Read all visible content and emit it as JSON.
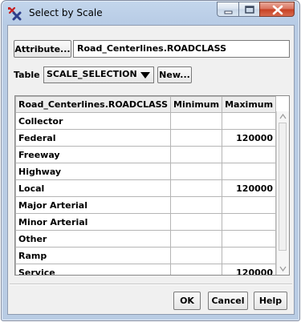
{
  "window": {
    "title": "Select by Scale",
    "icon": "scale-select-app-icon",
    "controls": [
      "minimize-icon",
      "maximize-icon",
      "close-icon"
    ]
  },
  "attribute": {
    "button_label": "Attribute...",
    "value": "Road_Centerlines.ROADCLASS"
  },
  "table_row": {
    "label": "Table",
    "selected": "SCALE_SELECTION",
    "new_label": "New..."
  },
  "grid": {
    "columns": [
      "Road_Centerlines.ROADCLASS",
      "Minimum",
      "Maximum"
    ],
    "rows": [
      {
        "name": "Collector",
        "min": "",
        "max": ""
      },
      {
        "name": "Federal",
        "min": "",
        "max": "120000"
      },
      {
        "name": "Freeway",
        "min": "",
        "max": ""
      },
      {
        "name": "Highway",
        "min": "",
        "max": ""
      },
      {
        "name": "Local",
        "min": "",
        "max": "120000"
      },
      {
        "name": "Major Arterial",
        "min": "",
        "max": ""
      },
      {
        "name": "Minor Arterial",
        "min": "",
        "max": ""
      },
      {
        "name": "Other",
        "min": "",
        "max": ""
      },
      {
        "name": "Ramp",
        "min": "",
        "max": ""
      },
      {
        "name": "Service",
        "min": "",
        "max": "120000"
      }
    ]
  },
  "footer": {
    "ok": "OK",
    "cancel": "Cancel",
    "help": "Help"
  }
}
